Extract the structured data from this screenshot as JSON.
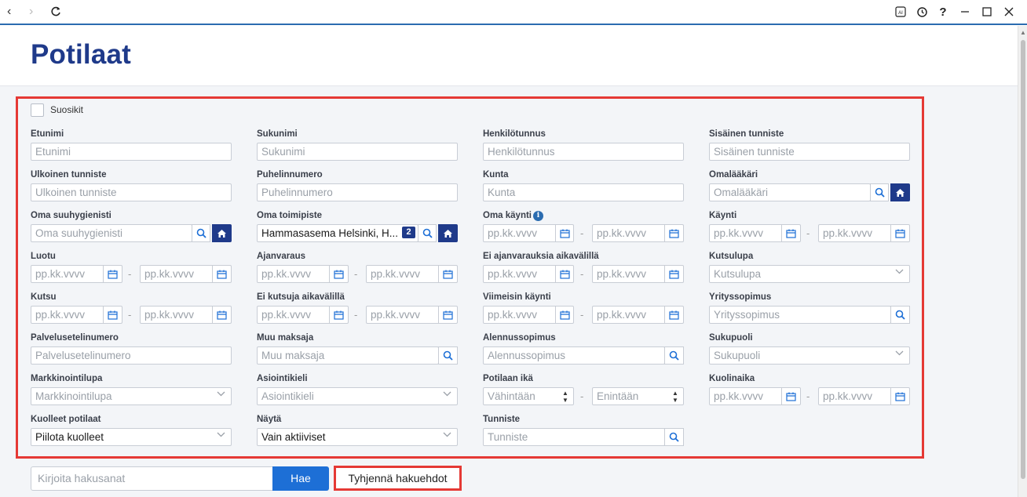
{
  "page": {
    "title": "Potilaat"
  },
  "favorites": {
    "label": "Suosikit",
    "checked": false
  },
  "fields": {
    "etunimi": {
      "label": "Etunimi",
      "placeholder": "Etunimi"
    },
    "sukunimi": {
      "label": "Sukunimi",
      "placeholder": "Sukunimi"
    },
    "henkilotunnus": {
      "label": "Henkilötunnus",
      "placeholder": "Henkilötunnus"
    },
    "sisainen": {
      "label": "Sisäinen tunniste",
      "placeholder": "Sisäinen tunniste"
    },
    "ulkoinen": {
      "label": "Ulkoinen tunniste",
      "placeholder": "Ulkoinen tunniste"
    },
    "puhelin": {
      "label": "Puhelinnumero",
      "placeholder": "Puhelinnumero"
    },
    "kunta": {
      "label": "Kunta",
      "placeholder": "Kunta"
    },
    "omalaakari": {
      "label": "Omalääkäri",
      "placeholder": "Omalääkäri"
    },
    "suuhygienisti": {
      "label": "Oma suuhygienisti",
      "placeholder": "Oma suuhygienisti"
    },
    "toimipiste": {
      "label": "Oma toimipiste",
      "value": "Hammasasema Helsinki, H...",
      "count": "2"
    },
    "oma_kaynti": {
      "label": "Oma käynti",
      "from": "pp.kk.vvvv",
      "to": "pp.kk.vvvv"
    },
    "kaynti": {
      "label": "Käynti",
      "from": "pp.kk.vvvv",
      "to": "pp.kk.vvvv"
    },
    "luotu": {
      "label": "Luotu",
      "from": "pp.kk.vvvv",
      "to": "pp.kk.vvvv"
    },
    "ajanvaraus": {
      "label": "Ajanvaraus",
      "from": "pp.kk.vvvv",
      "to": "pp.kk.vvvv"
    },
    "ei_ajanvarauksia": {
      "label": "Ei ajanvarauksia aikavälillä",
      "from": "pp.kk.vvvv",
      "to": "pp.kk.vvvv"
    },
    "kutsulupa": {
      "label": "Kutsulupa",
      "placeholder": "Kutsulupa"
    },
    "kutsu": {
      "label": "Kutsu",
      "from": "pp.kk.vvvv",
      "to": "pp.kk.vvvv"
    },
    "ei_kutsuja": {
      "label": "Ei kutsuja aikavälillä",
      "from": "pp.kk.vvvv",
      "to": "pp.kk.vvvv"
    },
    "viimeisin": {
      "label": "Viimeisin käynti",
      "from": "pp.kk.vvvv",
      "to": "pp.kk.vvvv"
    },
    "yrityssopimus": {
      "label": "Yrityssopimus",
      "placeholder": "Yrityssopimus"
    },
    "palveluseteli": {
      "label": "Palvelusetelinumero",
      "placeholder": "Palvelusetelinumero"
    },
    "muu_maksaja": {
      "label": "Muu maksaja",
      "placeholder": "Muu maksaja"
    },
    "alennussopimus": {
      "label": "Alennussopimus",
      "placeholder": "Alennussopimus"
    },
    "sukupuoli": {
      "label": "Sukupuoli",
      "placeholder": "Sukupuoli"
    },
    "markkinointi": {
      "label": "Markkinointilupa",
      "placeholder": "Markkinointilupa"
    },
    "asiointikieli": {
      "label": "Asiointikieli",
      "placeholder": "Asiointikieli"
    },
    "potilaan_ika": {
      "label": "Potilaan ikä",
      "min": "Vähintään",
      "max": "Enintään"
    },
    "kuolinaika": {
      "label": "Kuolinaika",
      "from": "pp.kk.vvvv",
      "to": "pp.kk.vvvv"
    },
    "kuolleet": {
      "label": "Kuolleet potilaat",
      "value": "Piilota kuolleet"
    },
    "nayta": {
      "label": "Näytä",
      "value": "Vain aktiiviset"
    },
    "tunniste": {
      "label": "Tunniste",
      "placeholder": "Tunniste"
    }
  },
  "search": {
    "placeholder": "Kirjoita hakusanat",
    "button": "Hae",
    "clear": "Tyhjennä hakuehdot"
  },
  "colors": {
    "brand": "#1f3a8a",
    "accent": "#1d6fd6",
    "highlight": "#e53935"
  }
}
